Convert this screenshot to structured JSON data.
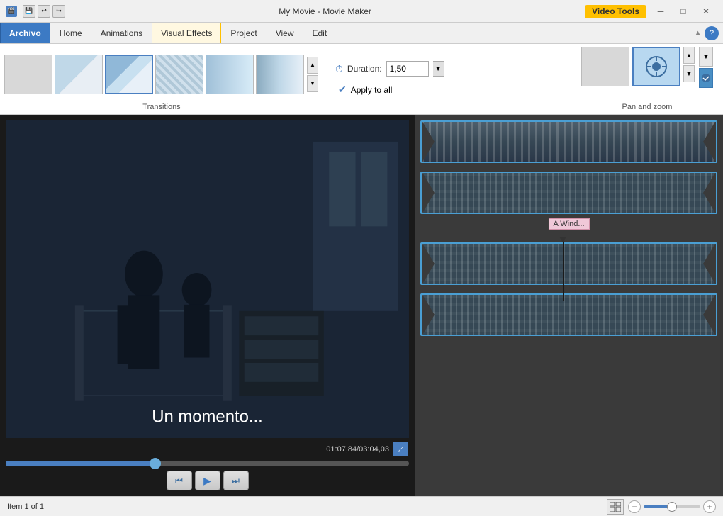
{
  "titlebar": {
    "app_icon": "🎬",
    "title": "My Movie - Movie Maker",
    "video_tools_label": "Video Tools",
    "minimize": "─",
    "maximize": "□",
    "close": "✕"
  },
  "menubar": {
    "tabs": [
      {
        "id": "archivo",
        "label": "Archivo",
        "active": true
      },
      {
        "id": "home",
        "label": "Home"
      },
      {
        "id": "animations",
        "label": "Animations"
      },
      {
        "id": "visual_effects",
        "label": "Visual Effects"
      },
      {
        "id": "project",
        "label": "Project"
      },
      {
        "id": "view",
        "label": "View"
      },
      {
        "id": "edit",
        "label": "Edit"
      }
    ]
  },
  "ribbon": {
    "transitions_label": "Transitions",
    "pan_zoom_label": "Pan and zoom",
    "duration_label": "Duration:",
    "duration_value": "1,50",
    "apply_all_label": "Apply to all",
    "scroll_up": "▲",
    "scroll_down": "▼",
    "dropdown": "▼",
    "nav_up": "▲",
    "nav_down": "▼"
  },
  "video": {
    "subtitle": "Un momento...",
    "timecode": "01:07,84/03:04,03"
  },
  "timeline": {
    "clips": [
      {
        "id": "clip1",
        "has_label": false
      },
      {
        "id": "clip2",
        "has_label": true,
        "label": "A Wind..."
      },
      {
        "id": "clip3",
        "has_label": false
      },
      {
        "id": "clip4",
        "has_label": false
      }
    ]
  },
  "statusbar": {
    "item_status": "Item 1 of 1",
    "zoom_minus": "−",
    "zoom_plus": "+"
  }
}
